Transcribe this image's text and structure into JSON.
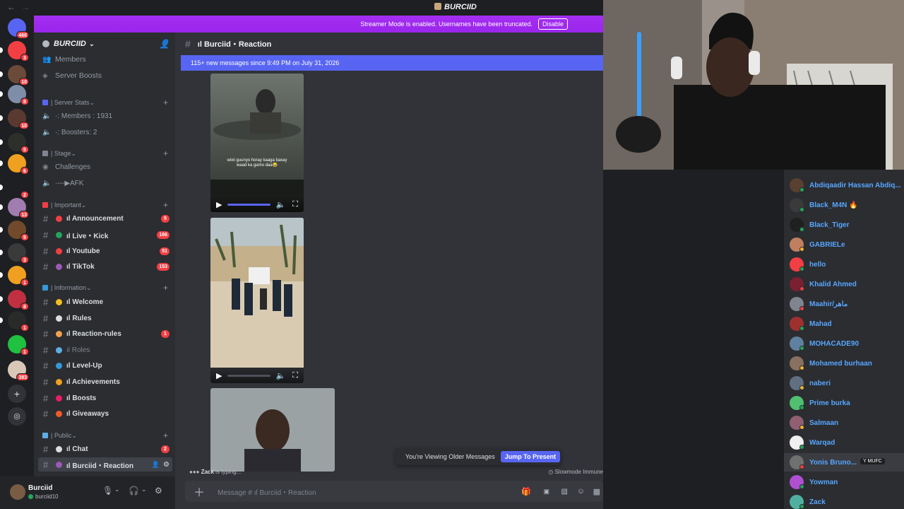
{
  "window": {
    "title": "BURCIID"
  },
  "streamer_banner": {
    "text": "Streamer Mode is enabled. Usernames have been truncated.",
    "button": "Disable"
  },
  "guilds": [
    {
      "color": "#5865f2",
      "badge": "466"
    },
    {
      "color": "#f23f43",
      "badge": "3"
    },
    {
      "color": "#6b4a3a",
      "badge": "10"
    },
    {
      "color": "#7f8ea8",
      "badge": "8"
    },
    {
      "color": "#5a3a30",
      "badge": "10"
    },
    {
      "color": "#2d2f2a",
      "badge": "5"
    },
    {
      "color": "#f0a020",
      "badge": "6"
    },
    {
      "color": "#1e1f22",
      "badge": "2"
    },
    {
      "color": "#a07cb0",
      "badge": "13"
    },
    {
      "color": "#704a2a",
      "badge": "5"
    },
    {
      "color": "#3a3a3a",
      "badge": "3"
    },
    {
      "color": "#f0a020",
      "badge": "1"
    },
    {
      "color": "#c03040",
      "badge": "8"
    },
    {
      "color": "#2a2a2a",
      "badge": "1"
    },
    {
      "color": "#20c040",
      "badge": "1"
    },
    {
      "color": "#d9c8b8",
      "badge": "383"
    }
  ],
  "server": {
    "name": "BURCIID"
  },
  "sidebar": {
    "top": [
      {
        "label": "Members"
      },
      {
        "label": "Server Boosts"
      }
    ],
    "server_stats": {
      "category": "| Server Stats",
      "items": [
        "·: Members : 1931",
        "·: Boosters: 2"
      ]
    },
    "stage": {
      "category": "| Stage",
      "items": [
        "Challenges",
        "·---▶AFK"
      ]
    },
    "important": {
      "category": "| Important",
      "items": [
        {
          "label": "ıl Announcement",
          "badge": "5",
          "color": "#f23f43"
        },
        {
          "label": "ıl Live・Kick",
          "badge": "166",
          "color": "#23a55a"
        },
        {
          "label": "ıl Youtube",
          "badge": "51",
          "color": "#f23f43"
        },
        {
          "label": "ıl TikTok",
          "badge": "153",
          "color": "#9b59b6"
        }
      ]
    },
    "information": {
      "category": "| Information",
      "items": [
        {
          "label": "ıl Welcome",
          "badge": "",
          "color": "#f0c020",
          "muted": false
        },
        {
          "label": "ıl Rules",
          "badge": "",
          "color": "#dbdee1",
          "muted": false
        },
        {
          "label": "ıl Reaction-rules",
          "badge": "1",
          "color": "#f0a050",
          "muted": false
        },
        {
          "label": "ıl Roles",
          "badge": "",
          "color": "#5dade2",
          "muted": true
        },
        {
          "label": "ıl Level-Up",
          "badge": "",
          "color": "#3498db",
          "muted": false
        },
        {
          "label": "ıl Achievements",
          "badge": "",
          "color": "#f0a020",
          "muted": false
        },
        {
          "label": "ıl Boosts",
          "badge": "",
          "color": "#e91e63",
          "muted": false
        },
        {
          "label": "ıl Giveaways",
          "badge": "",
          "color": "#f05a28",
          "muted": false
        }
      ]
    },
    "public": {
      "category": "| Public",
      "items": [
        {
          "label": "ıl Chat",
          "badge": "2",
          "color": "#dbdee1"
        },
        {
          "label": "ıl Burciid・Reaction",
          "badge": "",
          "color": "#9b59b6"
        }
      ]
    }
  },
  "user": {
    "name": "Burciid",
    "tag": "burciid10"
  },
  "chat": {
    "channel": "ıl Burciid・Reaction",
    "new_messages": "115+ new messages since 9:49 PM on July 31, 2026",
    "video1_caption": "wixii guunyo horay kaaga baxay waad ka gamo daa😂",
    "older_text": "You're Viewing Older Messages",
    "jump_label": "Jump To Present",
    "typing_user": "Zack",
    "typing_text": " is typing...",
    "slowmode": "Slowmode Immune",
    "composer_placeholder": "Message # ıl Burciid・Reaction"
  },
  "members": [
    {
      "name": "Abdiqaadir Hassan Abdiq...",
      "color": "#5a4030",
      "status": "#23a55a"
    },
    {
      "name": "Black_M4N 🔥",
      "color": "#3a3a3a",
      "status": "#23a55a"
    },
    {
      "name": "Black_Tiger",
      "color": "#202020",
      "status": "#23a55a"
    },
    {
      "name": "GABRIELe",
      "color": "#c08060",
      "status": "#f0b232"
    },
    {
      "name": "hello",
      "color": "#f23f43",
      "status": "#23a55a"
    },
    {
      "name": "Khalid Ahmed",
      "color": "#7a2030",
      "status": "#f23f43"
    },
    {
      "name": "Maahir/ماهر",
      "color": "#80848e",
      "status": "#f23f43"
    },
    {
      "name": "Mahad",
      "color": "#a03030",
      "status": "#23a55a"
    },
    {
      "name": "MOHACADE90",
      "color": "#6080a0",
      "status": "#23a55a"
    },
    {
      "name": "Mohamed burhaan",
      "color": "#8a7060",
      "status": "#f0b232"
    },
    {
      "name": "naberi",
      "color": "#607080",
      "status": "#f0b232"
    },
    {
      "name": "Prime burka",
      "color": "#50c070",
      "status": "#23a55a"
    },
    {
      "name": "Salmaan",
      "color": "#906070",
      "status": "#f0b232"
    },
    {
      "name": "Warqad",
      "color": "#f0f0f0",
      "status": "#23a55a"
    },
    {
      "name": "Yonis Bruno...",
      "color": "#707070",
      "status": "#f23f43",
      "tag": "Y MUFC"
    },
    {
      "name": "Yowman",
      "color": "#b050d0",
      "status": "#23a55a"
    },
    {
      "name": "Zack",
      "color": "#50b0a0",
      "status": "#23a55a"
    }
  ]
}
